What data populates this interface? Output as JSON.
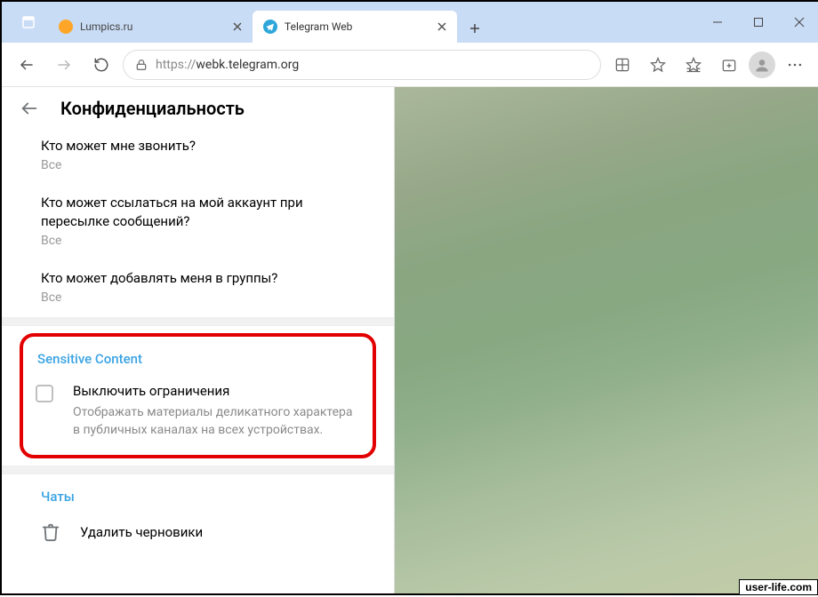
{
  "browser": {
    "tabs": [
      {
        "title": "Lumpics.ru",
        "active": false
      },
      {
        "title": "Telegram Web",
        "active": true
      }
    ],
    "url_protocol": "https://",
    "url_rest": "webk.telegram.org"
  },
  "panel": {
    "title": "Конфиденциальность",
    "settings": [
      {
        "title": "Кто может мне звонить?",
        "value": "Все"
      },
      {
        "title": "Кто может ссылаться на мой аккаунт при пересылке сообщений?",
        "value": "Все"
      },
      {
        "title": "Кто может добавлять меня в группы?",
        "value": "Все"
      }
    ],
    "sensitive": {
      "header": "Sensitive Content",
      "checkbox_label": "Выключить ограничения",
      "checkbox_desc": "Отображать материалы деликатного характера в публичных каналах на всех устройствах."
    },
    "chats_header": "Чаты",
    "delete_drafts": "Удалить черновики"
  },
  "watermark": "user-life.com"
}
